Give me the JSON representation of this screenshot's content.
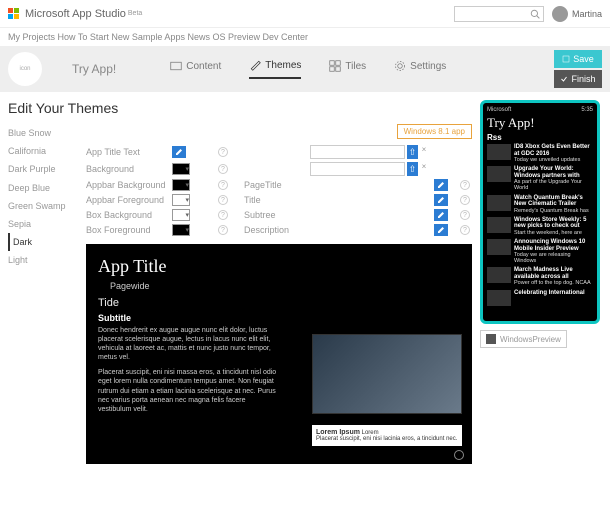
{
  "header": {
    "brand": "Microsoft App Studio",
    "beta": "Beta",
    "username": "Martina"
  },
  "topnav": {
    "items": [
      "My Projects",
      "How To Start",
      "New Sample Apps",
      "News",
      "OS Preview",
      "Dev Center"
    ]
  },
  "ribbon": {
    "app_name": "Try App!",
    "tabs": {
      "content": "Content",
      "themes": "Themes",
      "tiles": "Tiles",
      "settings": "Settings"
    },
    "save": "Save",
    "finish": "Finish"
  },
  "page_title": "Edit Your Themes",
  "win_badge": "Windows 8.1 app",
  "themes": [
    "Blue Snow",
    "California",
    "Dark Purple",
    "Deep Blue",
    "Green Swamp",
    "Sepia",
    "Dark",
    "Light"
  ],
  "selected_theme": "Dark",
  "props_left": [
    {
      "label": "App Title Text",
      "type": "edit"
    },
    {
      "label": "Background",
      "type": "color",
      "color": "black"
    },
    {
      "label": "Appbar Background",
      "type": "color",
      "color": "black"
    },
    {
      "label": "Appbar Foreground",
      "type": "color",
      "color": "white"
    },
    {
      "label": "Box Background",
      "type": "color",
      "color": "white"
    },
    {
      "label": "Box Foreground",
      "type": "color",
      "color": "black"
    }
  ],
  "props_right": [
    {
      "label": "",
      "type": "upload"
    },
    {
      "label": "",
      "type": "upload"
    },
    {
      "label": "PageTitle",
      "type": "edit"
    },
    {
      "label": "Title",
      "type": "edit"
    },
    {
      "label": "Subtree",
      "type": "edit"
    },
    {
      "label": "Description",
      "type": "edit"
    }
  ],
  "preview": {
    "title": "App Title",
    "page": "Pagewide",
    "tide": "Tide",
    "subtitle": "Subtitle",
    "body1": "Donec hendrerit ex augue augue nunc elit dolor, luctus placerat scelerisque augue, lectus in lacus nunc elit elit, vehicula at laoreet ac, mattis et nunc justo nunc tempor, metus vel.",
    "body2": "Placerat suscipit, eni nisi massa eros, a tincidunt nisl odio eget lorem nulla condimentum tempus amet. Non feugiat rutrum dui etiam a etiam lacinia scelerisque at nec. Purus nec varius porta aenean nec magna felis facere vestibulum velit.",
    "card_title": "Lorem Ipsum",
    "card_sub": "Lorem",
    "card_body": "Placerat suscipit, eni nisi lacinia eros, a tincidunt nec."
  },
  "phone": {
    "carrier": "Microsoft",
    "time": "5:35",
    "title": "Try App!",
    "section": "Rss",
    "items": [
      {
        "h": "ID8 Xbox Gets Even Better at GDC 2016",
        "s": "Today we unveiled updates"
      },
      {
        "h": "Upgrade Your World: Windows partners with",
        "s": "As part of the Upgrade Your World"
      },
      {
        "h": "Watch Quantum Break's New Cinematic Trailer",
        "s": "Remedy's Quantum Break has"
      },
      {
        "h": "Windows Store Weekly: 5 new picks to check out",
        "s": "Start the weekend, here are"
      },
      {
        "h": "Announcing Windows 10 Mobile Insider Preview",
        "s": "Today we are releasing Windows"
      },
      {
        "h": "March Madness Live available across all",
        "s": "Power off to the top dog. NCAA"
      },
      {
        "h": "Celebrating International",
        "s": ""
      }
    ]
  },
  "wp_label": "WindowsPreview"
}
